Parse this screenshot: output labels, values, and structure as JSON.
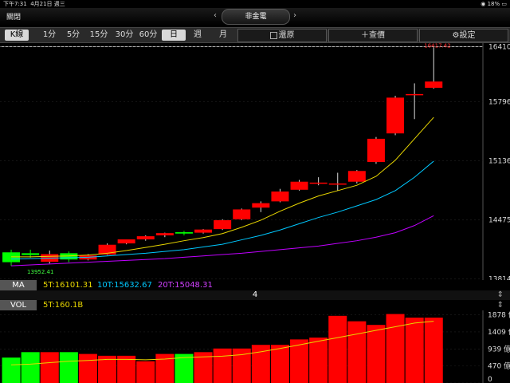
{
  "status": {
    "time": "下午7:31",
    "date": "4月21日 週三",
    "battery_pct": "18%"
  },
  "nav": {
    "close": "關閉",
    "title": "非金電",
    "prev": "‹",
    "next": "›"
  },
  "toolbar": {
    "k_line": "K線",
    "periods": [
      "1分",
      "5分",
      "15分",
      "30分",
      "60分",
      "日",
      "週",
      "月"
    ],
    "selected_period": "日",
    "restore": "還原",
    "lookup": "查價",
    "settings": "設定"
  },
  "price_axis": {
    "ticks": [
      "16410.28",
      "15796",
      "15136",
      "14475",
      "13814"
    ],
    "high_label": "16417.42",
    "low_label": "13952.41"
  },
  "ma": {
    "label": "MA",
    "ma5": "5T:16101.31",
    "ma10": "10T:15632.67",
    "ma20": "20T:15048.31"
  },
  "separator": {
    "text": "4"
  },
  "vol": {
    "label": "VOL",
    "v5": "5T:160.1B",
    "ticks": [
      "1878 億",
      "1409 億",
      "939 億",
      "470 億",
      "0"
    ]
  },
  "colors": {
    "up": "#ff0000",
    "down": "#00ff00",
    "ma5": "#e8d600",
    "ma10": "#00c8ff",
    "ma20": "#c000ff"
  },
  "chart_data": {
    "type": "candlestick",
    "ohlc": [
      {
        "o": 14110,
        "h": 14140,
        "l": 13960,
        "c": 14000
      },
      {
        "o": 14100,
        "h": 14140,
        "l": 14050,
        "c": 14080
      },
      {
        "o": 14005,
        "h": 14130,
        "l": 13985,
        "c": 14090
      },
      {
        "o": 14100,
        "h": 14120,
        "l": 14000,
        "c": 14030
      },
      {
        "o": 14030,
        "h": 14090,
        "l": 14020,
        "c": 14075
      },
      {
        "o": 14085,
        "h": 14210,
        "l": 14080,
        "c": 14195
      },
      {
        "o": 14210,
        "h": 14250,
        "l": 14200,
        "c": 14255
      },
      {
        "o": 14255,
        "h": 14300,
        "l": 14240,
        "c": 14290
      },
      {
        "o": 14300,
        "h": 14330,
        "l": 14280,
        "c": 14325
      },
      {
        "o": 14335,
        "h": 14350,
        "l": 14300,
        "c": 14320
      },
      {
        "o": 14330,
        "h": 14370,
        "l": 14320,
        "c": 14365
      },
      {
        "o": 14370,
        "h": 14480,
        "l": 14360,
        "c": 14470
      },
      {
        "o": 14480,
        "h": 14600,
        "l": 14470,
        "c": 14590
      },
      {
        "o": 14610,
        "h": 14680,
        "l": 14560,
        "c": 14660
      },
      {
        "o": 14680,
        "h": 14820,
        "l": 14670,
        "c": 14790
      },
      {
        "o": 14810,
        "h": 14920,
        "l": 14800,
        "c": 14900
      },
      {
        "o": 14880,
        "h": 14950,
        "l": 14860,
        "c": 14890
      },
      {
        "o": 14870,
        "h": 15000,
        "l": 14800,
        "c": 14880
      },
      {
        "o": 14900,
        "h": 15030,
        "l": 14880,
        "c": 15020
      },
      {
        "o": 15120,
        "h": 15400,
        "l": 15100,
        "c": 15380
      },
      {
        "o": 15440,
        "h": 15860,
        "l": 15420,
        "c": 15840
      },
      {
        "o": 15880,
        "h": 16000,
        "l": 15600,
        "c": 15880
      },
      {
        "o": 15950,
        "h": 16417.42,
        "l": 15940,
        "c": 16020
      }
    ],
    "ma5": [
      14060,
      14060,
      14065,
      14070,
      14080,
      14100,
      14130,
      14165,
      14200,
      14240,
      14275,
      14320,
      14390,
      14470,
      14570,
      14660,
      14740,
      14800,
      14860,
      14960,
      15140,
      15380,
      15620
    ],
    "ma10": [
      14035,
      14040,
      14045,
      14050,
      14055,
      14070,
      14085,
      14100,
      14120,
      14140,
      14170,
      14200,
      14250,
      14300,
      14360,
      14430,
      14500,
      14560,
      14630,
      14700,
      14800,
      14950,
      15130
    ],
    "ma20": [
      13960,
      13970,
      13980,
      13990,
      14000,
      14010,
      14020,
      14030,
      14040,
      14055,
      14070,
      14085,
      14100,
      14120,
      14140,
      14160,
      14180,
      14210,
      14240,
      14280,
      14330,
      14410,
      14520
    ],
    "volume": [
      700,
      850,
      850,
      850,
      800,
      750,
      750,
      600,
      800,
      800,
      850,
      950,
      950,
      1050,
      1050,
      1200,
      1250,
      1850,
      1700,
      1600,
      1900,
      1800,
      1800
    ],
    "volume_ma": [
      500,
      520,
      560,
      600,
      620,
      650,
      650,
      640,
      660,
      700,
      720,
      740,
      780,
      860,
      950,
      1050,
      1150,
      1250,
      1350,
      1450,
      1550,
      1650,
      1700
    ],
    "ylim": [
      13800,
      16450
    ],
    "vol_ylim": [
      0,
      2000
    ]
  }
}
